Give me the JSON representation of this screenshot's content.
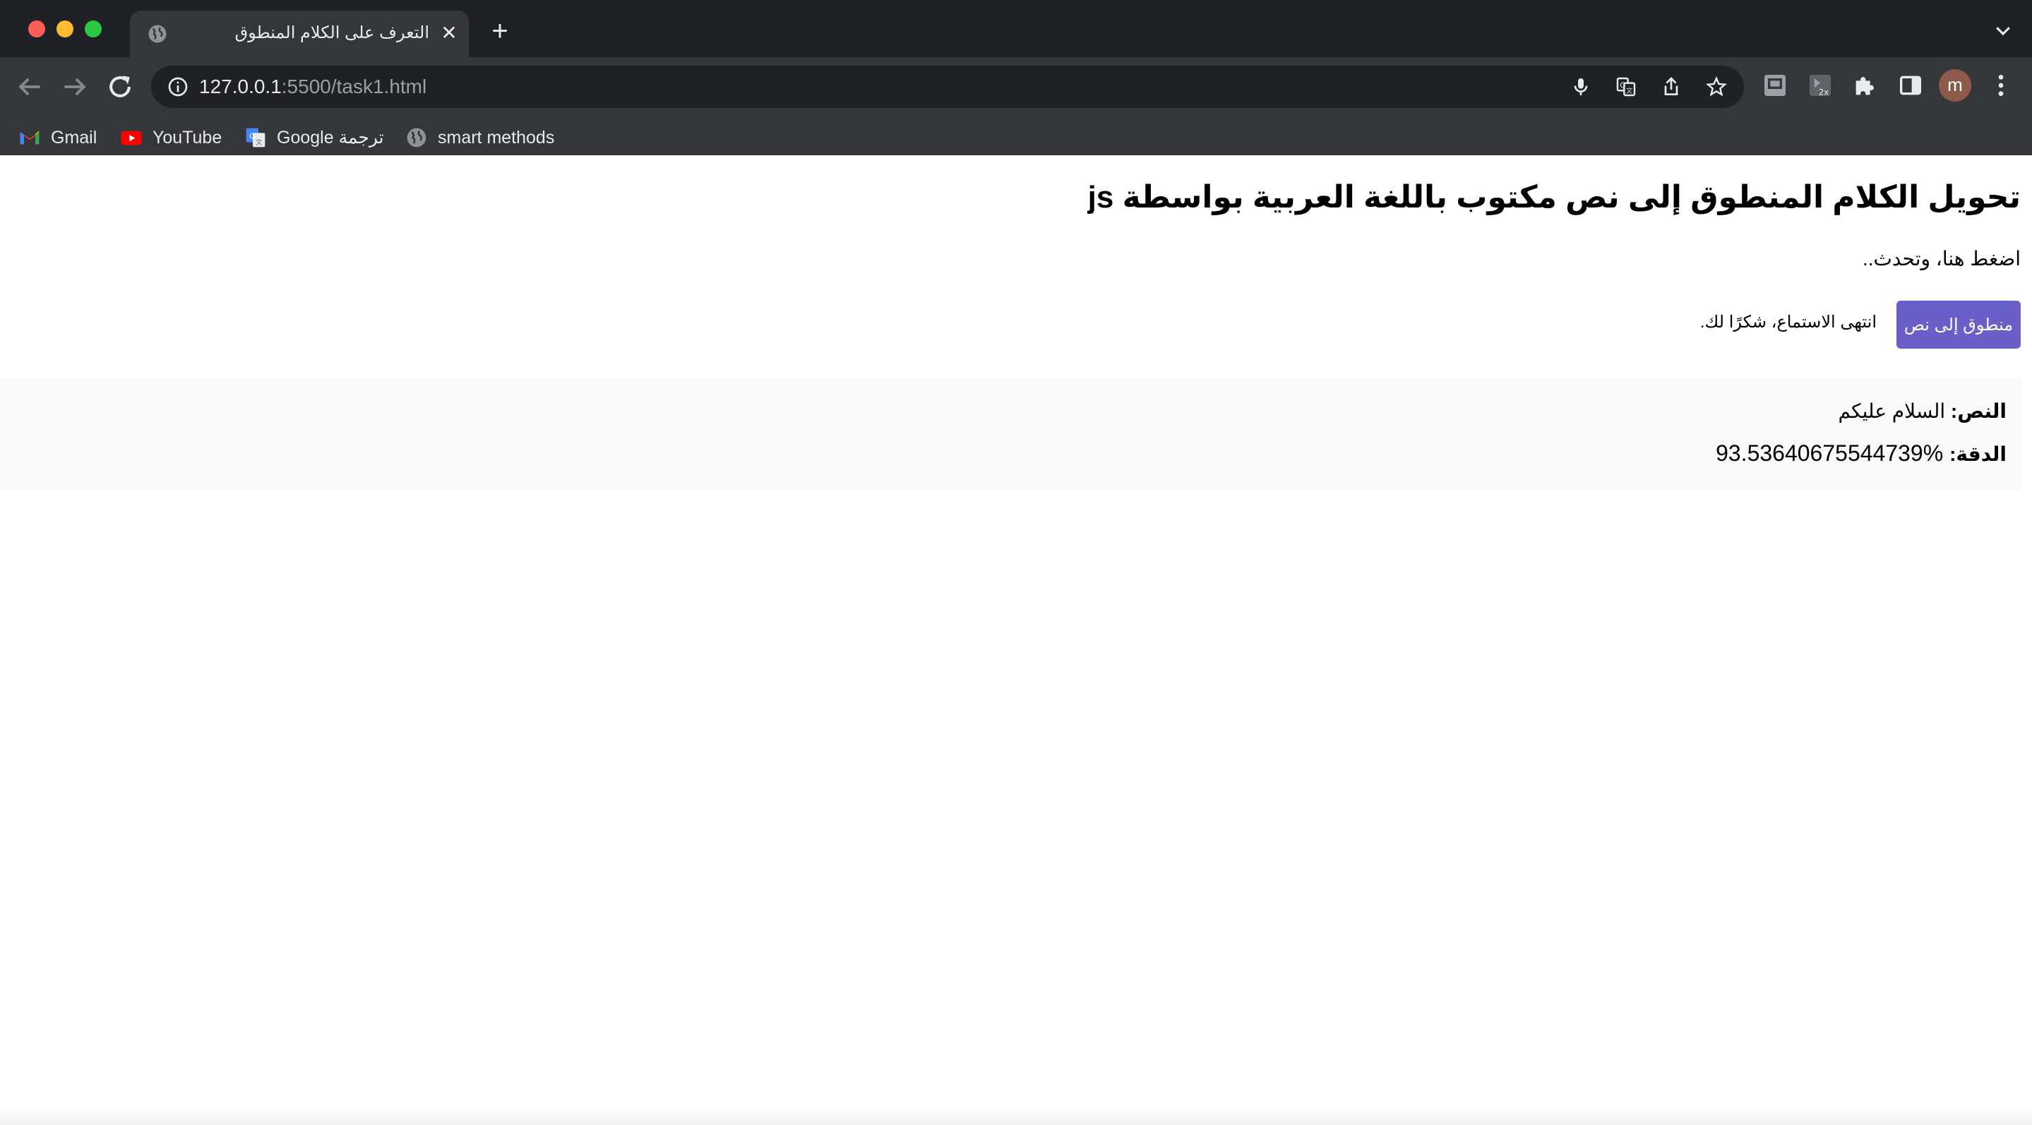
{
  "browser": {
    "tab": {
      "title": "التعرف على الكلام المنطوق",
      "icon": "globe-icon"
    },
    "url": {
      "host": "127.0.0.1",
      "rest": ":5500/task1.html"
    },
    "avatar_letter": "m",
    "bookmarks": [
      {
        "label": "Gmail",
        "icon": "gmail-icon"
      },
      {
        "label": "YouTube",
        "icon": "youtube-icon"
      },
      {
        "label": "Google ترجمة",
        "icon": "google-translate-icon"
      },
      {
        "label": "smart methods",
        "icon": "globe-icon"
      }
    ]
  },
  "page": {
    "title": "تحويل الكلام المنطوق إلى نص مكتوب باللغة العربية بواسطة js",
    "instruction": "اضغط هنا، وتحدث..",
    "convert_button": "منطوق إلى نص",
    "status": "انتهى الاستماع، شكرًا لك.",
    "result": {
      "text_label": "النص:",
      "text_value": "السلام عليكم",
      "accuracy_label": "الدقة:",
      "accuracy_value": "93.53640675544739%"
    }
  },
  "colors": {
    "chrome_dark": "#202124",
    "chrome_toolbar": "#35363a",
    "button_accent": "#6a5fc9",
    "result_bg": "#f9f9f9"
  }
}
